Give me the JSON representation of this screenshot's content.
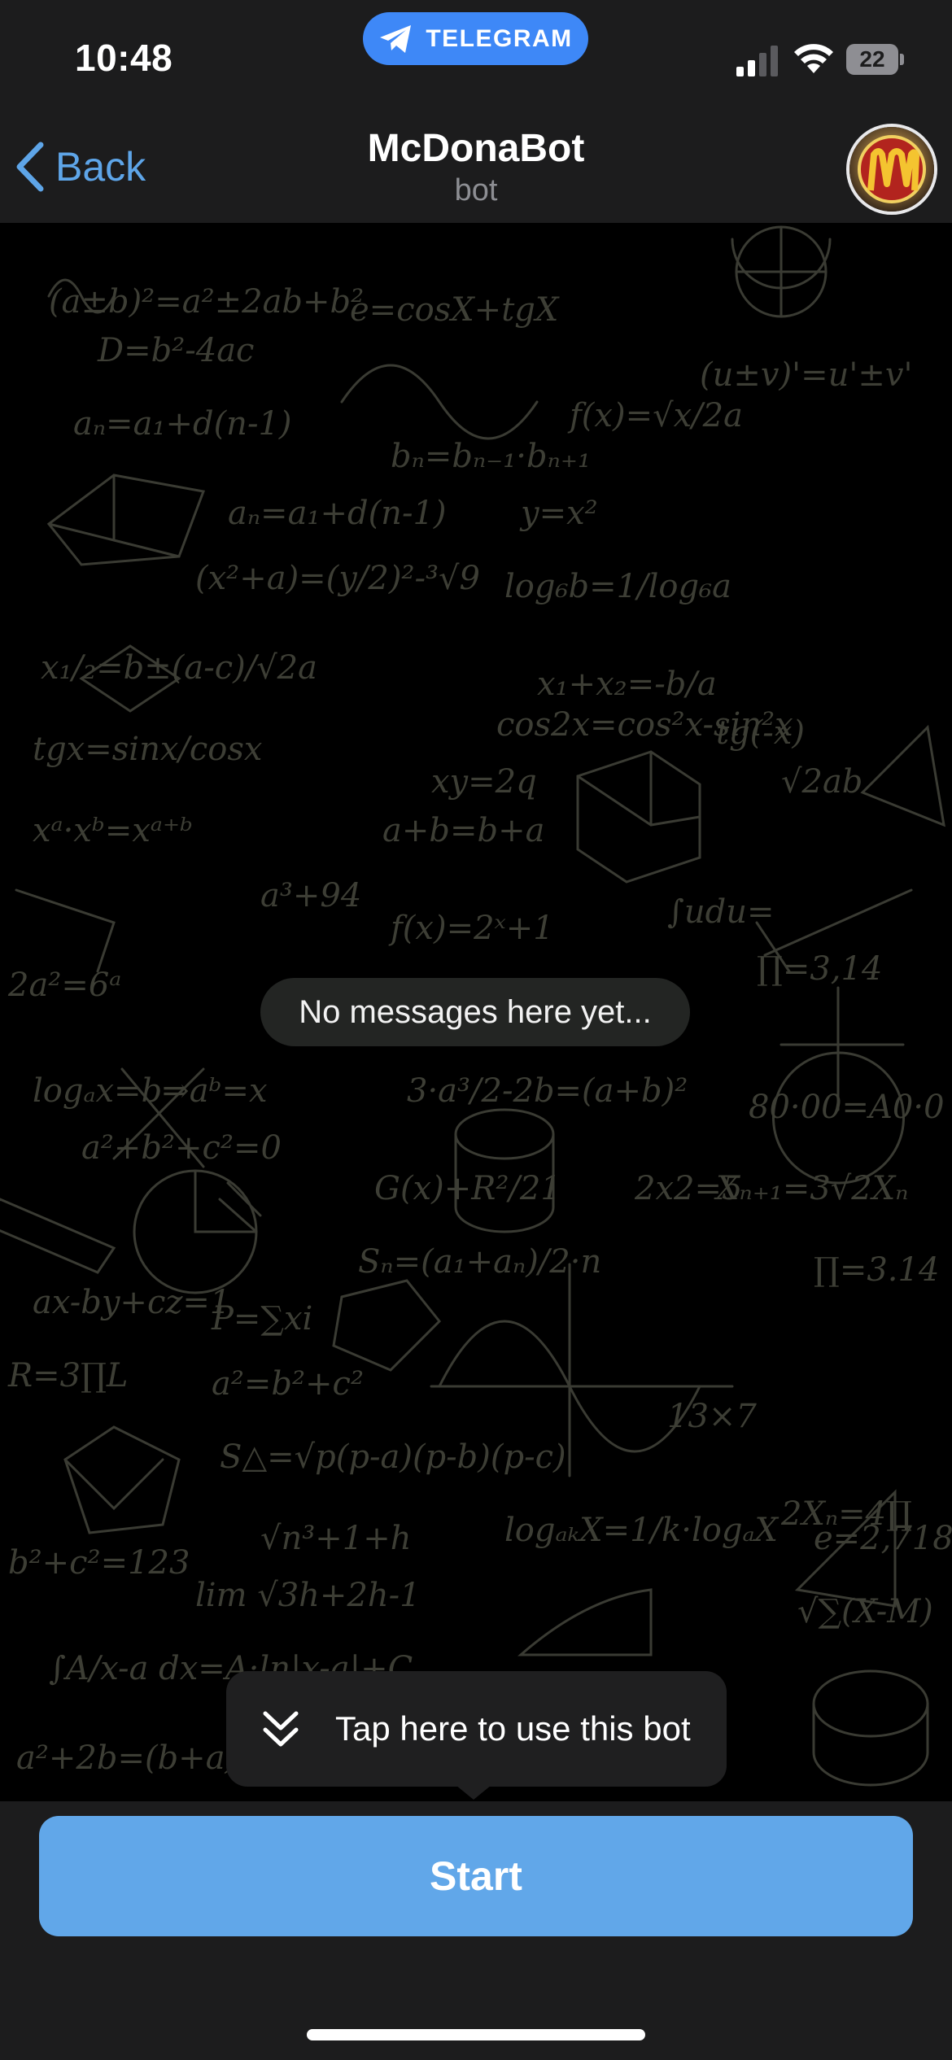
{
  "status_bar": {
    "time": "10:48",
    "app_pill": "TELEGRAM",
    "battery": "22",
    "icons": [
      "signal-icon",
      "wifi-icon",
      "battery-icon"
    ]
  },
  "nav": {
    "back_label": "Back",
    "title": "McDonaBot",
    "subtitle": "bot",
    "avatar_icon": "bot-avatar-mcdonalds-logo"
  },
  "chat": {
    "empty_text": "No messages here yet...",
    "tooltip_text": "Tap here to use this bot",
    "tooltip_icon": "double-chevron-down-icon"
  },
  "bottom": {
    "start_label": "Start"
  },
  "colors": {
    "accent": "#5ea5e8",
    "start_button": "#61a7e9",
    "telegram_pill": "#3e88f7",
    "bar_background": "#1c1c1d"
  }
}
